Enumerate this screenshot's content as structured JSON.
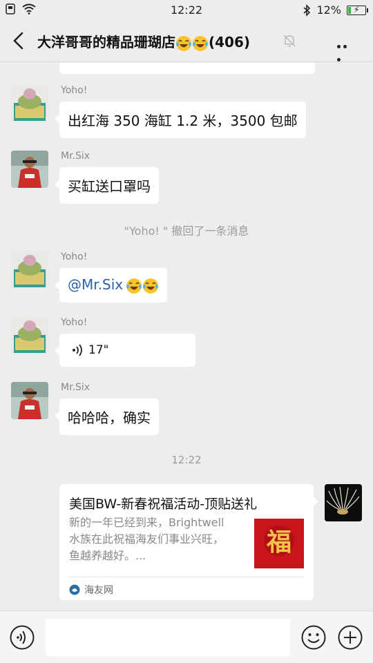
{
  "status": {
    "time": "12:22",
    "battery": "12%",
    "left_icons": [
      "notification-icon",
      "wifi-icon"
    ],
    "right_icons": [
      "bluetooth-icon",
      "battery-icon"
    ]
  },
  "header": {
    "title_prefix": "大洋哥哥的精品珊瑚店",
    "title_count": "(406)",
    "icons": [
      "back-icon",
      "laugh-cry-emoji-icon",
      "mute-bell-icon",
      "more-icon"
    ]
  },
  "messages": [
    {
      "sender": "Yoho!",
      "text": "出红海 350 海缸 1.2 米，3500 包邮"
    },
    {
      "sender": "Mr.Six",
      "text": "买缸送口罩吗"
    },
    {
      "system": "\"Yoho! \" 撤回了一条消息"
    },
    {
      "sender": "Yoho!",
      "mention": "@Mr.Six"
    },
    {
      "sender": "Yoho!",
      "voice_duration": "17\""
    },
    {
      "sender": "Mr.Six",
      "text": "哈哈哈，确实"
    }
  ],
  "time_separator": "12:22",
  "link_card": {
    "title": "美国BW-新春祝福活动-顶贴送礼",
    "desc": "新的一年已经到来，Brightwell水族在此祝福海友们事业兴旺，鱼越养越好。...",
    "thumb_char": "福",
    "source": "海友网"
  },
  "input": {
    "value": "",
    "icons": [
      "voice-input-icon",
      "emoji-icon",
      "plus-icon"
    ]
  },
  "colors": {
    "background": "#ededed",
    "bubble": "#ffffff",
    "mention": "#2a62a8",
    "system_text": "#9a9a9a",
    "battery_fill": "#3bb34a"
  }
}
